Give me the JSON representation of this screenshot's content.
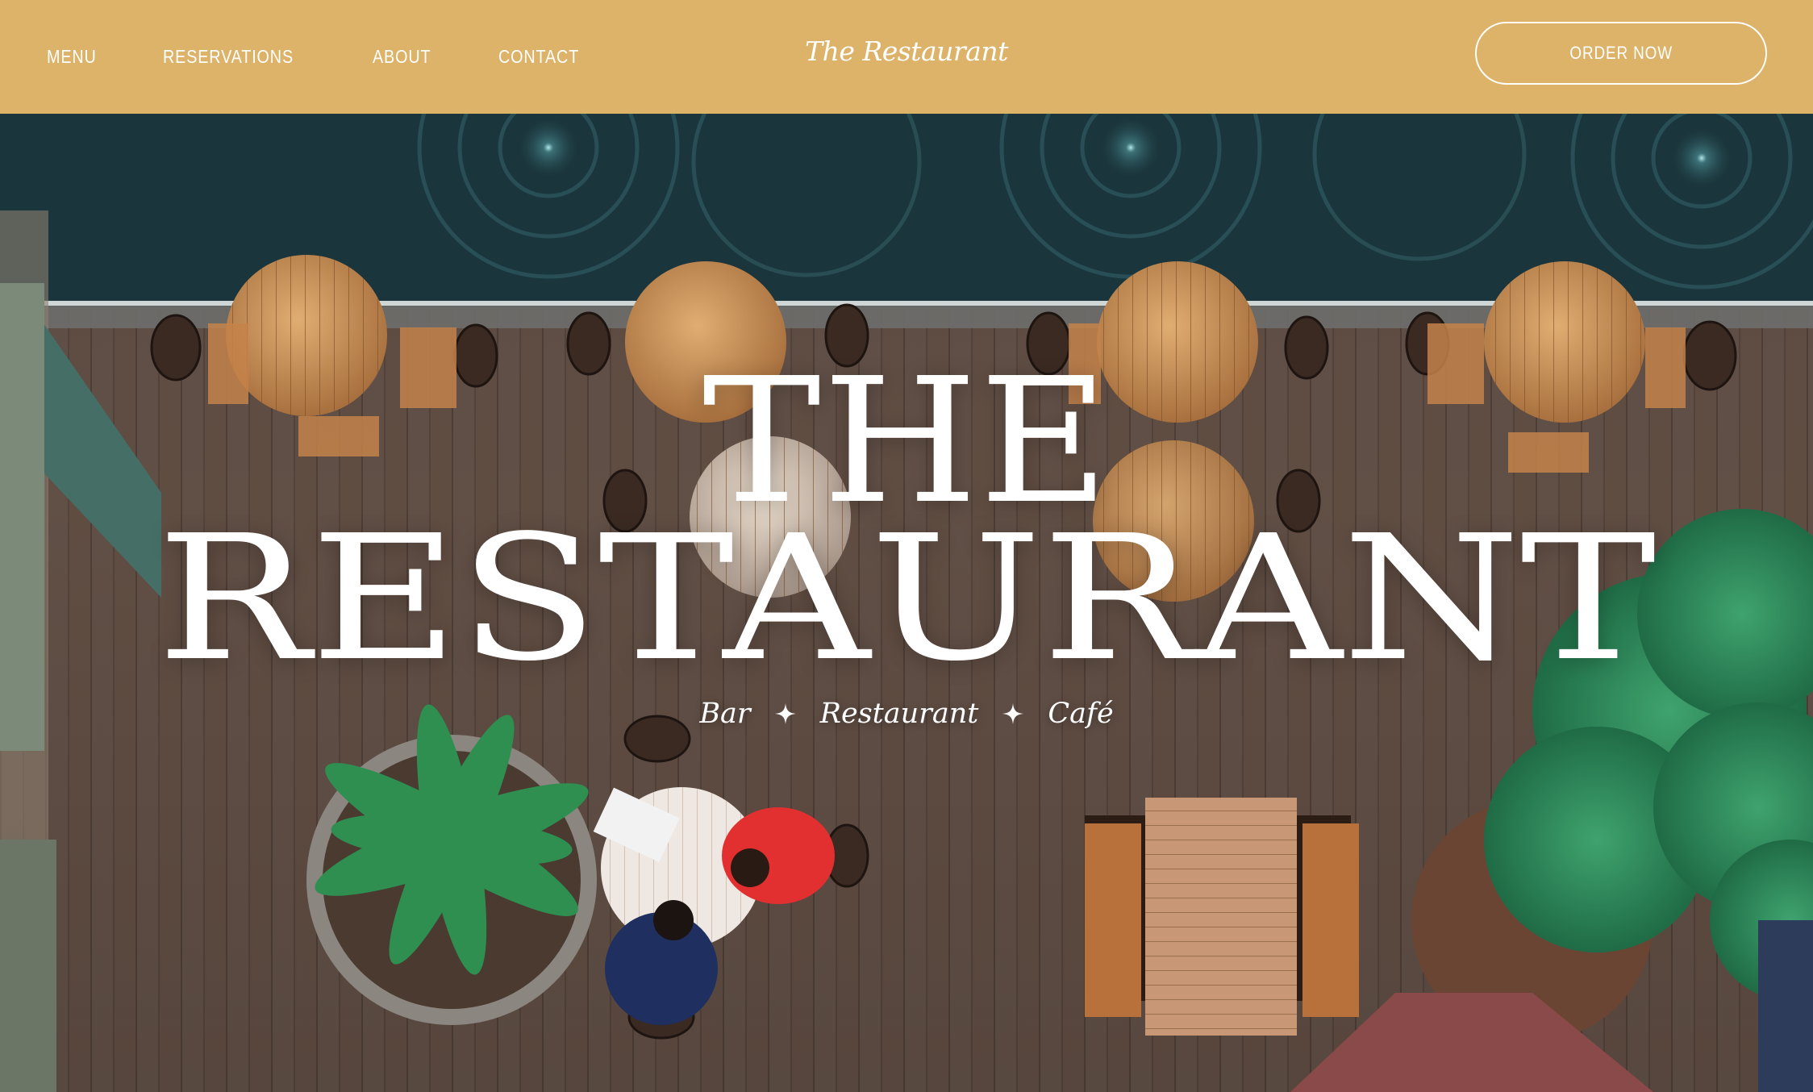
{
  "header": {
    "nav": [
      {
        "label": "MENU"
      },
      {
        "label": "RESERVATIONS"
      },
      {
        "label": "ABOUT"
      },
      {
        "label": "CONTACT"
      }
    ],
    "brand": "The Restaurant",
    "cta_label": "ORDER NOW"
  },
  "hero": {
    "title_line1": "THE",
    "title_line2": "RESTAURANT",
    "tagline": [
      "Bar",
      "Restaurant",
      "Café"
    ],
    "background_image": "overhead-restaurant-terrace-photo"
  },
  "colors": {
    "header_bg": "#dcb368",
    "text": "#ffffff",
    "water": "#1d3a40",
    "deck": "#5a4a42",
    "table_wood": "#c89058",
    "plant": "#2e8a5a"
  },
  "icons": [
    "sparkle-icon"
  ]
}
